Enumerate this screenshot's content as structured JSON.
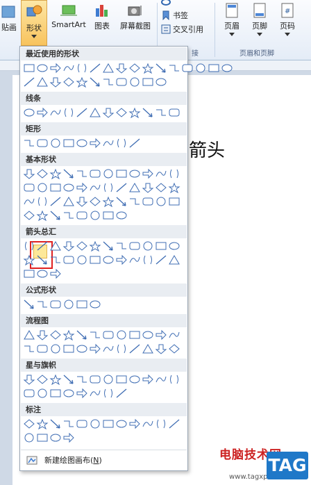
{
  "ribbon": {
    "paste_partial": "贴画",
    "shapes": "形状",
    "smartart": "SmartArt",
    "chart": "图表",
    "screenshot": "屏幕截图",
    "bookmark": "书签",
    "cross_reference": "交叉引用",
    "links_group_partial": "接",
    "header": "页眉",
    "footer": "页脚",
    "page_number": "页码",
    "header_footer_group": "页眉和页脚"
  },
  "document": {
    "text": "箭头"
  },
  "watermark": {
    "site_name": "电脑技术网",
    "site_url": "www.tagxp.com",
    "tag": "TAG"
  },
  "dropdown": {
    "sections": [
      {
        "title": "最近使用的形状",
        "rows": [
          16,
          11
        ]
      },
      {
        "title": "线条",
        "rows": [
          12
        ]
      },
      {
        "title": "矩形",
        "rows": [
          9
        ]
      },
      {
        "title": "基本形状",
        "rows": [
          12,
          12,
          12,
          8
        ]
      },
      {
        "title": "箭头总汇",
        "rows": [
          12,
          12,
          3
        ]
      },
      {
        "title": "公式形状",
        "rows": [
          6
        ]
      },
      {
        "title": "流程图",
        "rows": [
          12,
          12
        ]
      },
      {
        "title": "星与旗帜",
        "rows": [
          12,
          8
        ]
      },
      {
        "title": "标注",
        "rows": [
          12,
          4
        ]
      }
    ],
    "new_canvas": "新建绘图画布(",
    "new_canvas_key": "N",
    "new_canvas_end": ")"
  }
}
